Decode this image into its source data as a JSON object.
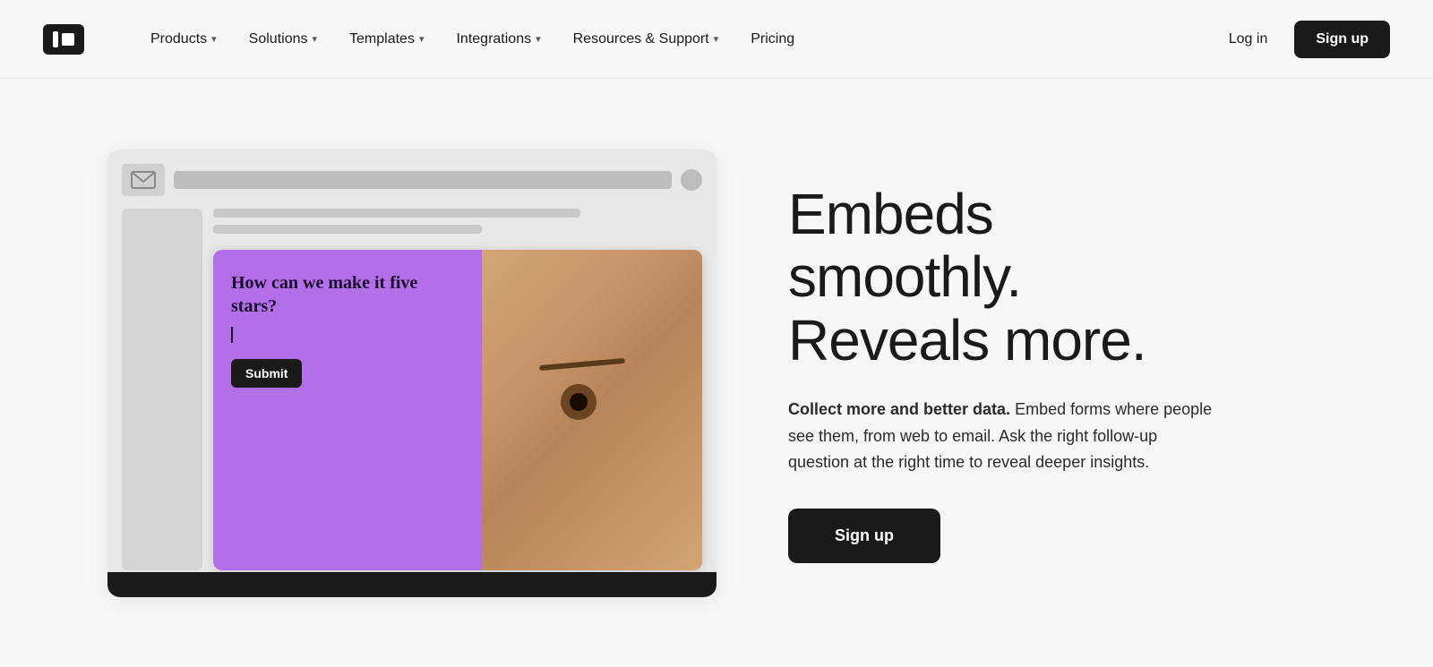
{
  "logo": {
    "label": "Typeform logo"
  },
  "nav": {
    "items": [
      {
        "id": "products",
        "label": "Products",
        "hasDropdown": true
      },
      {
        "id": "solutions",
        "label": "Solutions",
        "hasDropdown": true
      },
      {
        "id": "templates",
        "label": "Templates",
        "hasDropdown": true
      },
      {
        "id": "integrations",
        "label": "Integrations",
        "hasDropdown": true
      },
      {
        "id": "resources",
        "label": "Resources & Support",
        "hasDropdown": true
      },
      {
        "id": "pricing",
        "label": "Pricing",
        "hasDropdown": false
      }
    ],
    "login_label": "Log in",
    "signup_label": "Sign up"
  },
  "hero": {
    "title": "Embeds smoothly. Reveals more.",
    "description_bold": "Collect more and better data.",
    "description_rest": " Embed forms where people see them, from web to email. Ask the right follow-up question at the right time to reveal deeper insights.",
    "signup_label": "Sign up"
  },
  "mockup": {
    "form_question": "How can we make it five stars?",
    "form_cursor": "|",
    "form_submit": "Submit"
  }
}
